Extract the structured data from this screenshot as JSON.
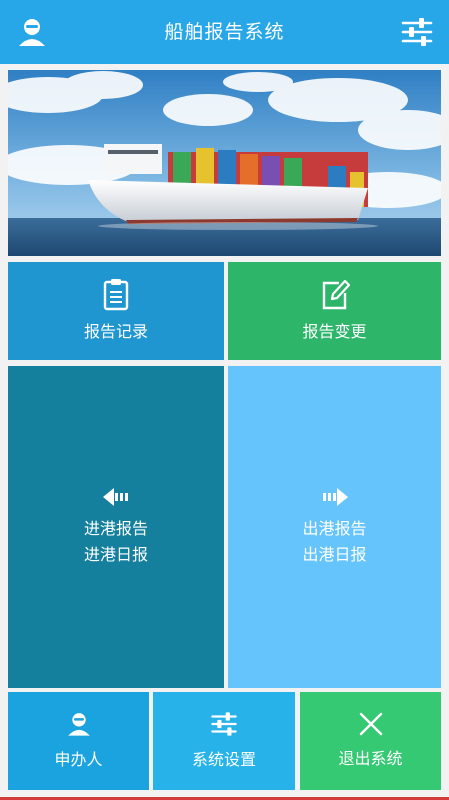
{
  "header": {
    "title": "船舶报告系统",
    "left_icon": "user-icon",
    "right_icon": "settings-sliders-icon"
  },
  "banner": {
    "image": "container-ship-photo"
  },
  "tiles": {
    "record": {
      "label": "报告记录",
      "icon": "clipboard-icon",
      "color": "#1f96cf"
    },
    "change": {
      "label": "报告变更",
      "icon": "edit-icon",
      "color": "#2db56a"
    },
    "inbound": {
      "line1": "进港报告",
      "line2": "进港日报",
      "icon": "arrow-left-icon",
      "color": "#15809e"
    },
    "outbound": {
      "line1": "出港报告",
      "line2": "出港日报",
      "icon": "arrow-right-icon",
      "color": "#65c4fb"
    },
    "applicant": {
      "label": "申办人",
      "icon": "user-icon",
      "color": "#1aa3de"
    },
    "settings": {
      "label": "系统设置",
      "icon": "settings-sliders-icon",
      "color": "#27b3ea"
    },
    "exit": {
      "label": "退出系统",
      "icon": "close-icon",
      "color": "#35c973"
    }
  },
  "colors": {
    "header": "#27a6e8",
    "accent_line": "#d23c3c"
  }
}
